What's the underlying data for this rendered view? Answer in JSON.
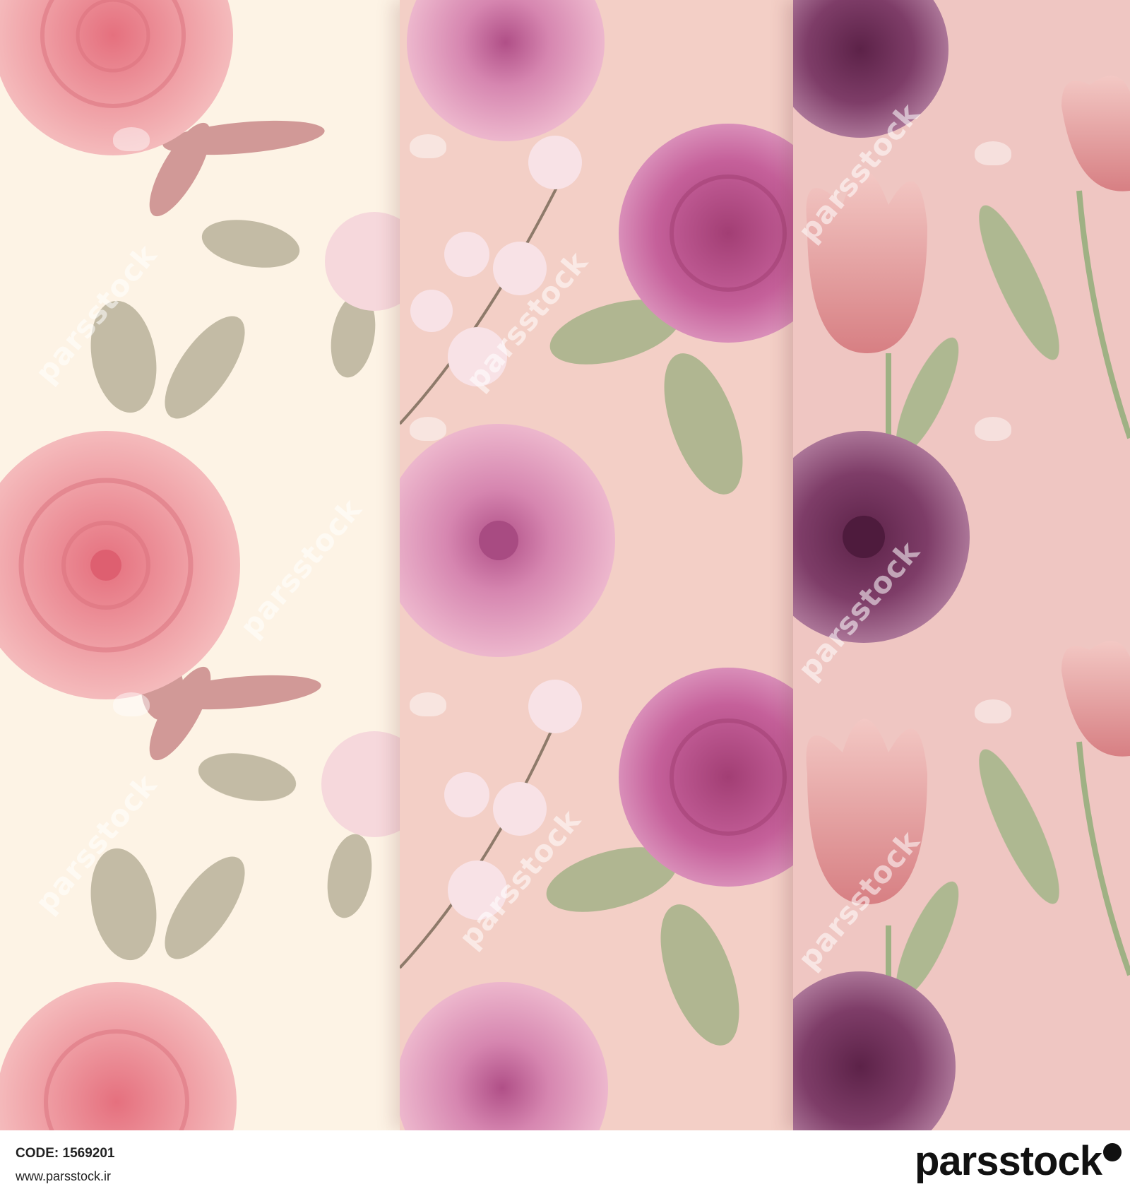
{
  "footer": {
    "code_text": "CODE: 1569201",
    "website": "www.parsstock.ir",
    "brand": "parsstock"
  },
  "watermark": {
    "text": "parsstock"
  },
  "colors": {
    "panel_left": "#fdf3e5",
    "panel_middle": "#f3cfc6",
    "panel_right": "#efc6c2",
    "rose": "#e8929b",
    "magenta_rose": "#b84f86",
    "dahlia": "#7c3a63",
    "leaf": "#9bae84"
  }
}
